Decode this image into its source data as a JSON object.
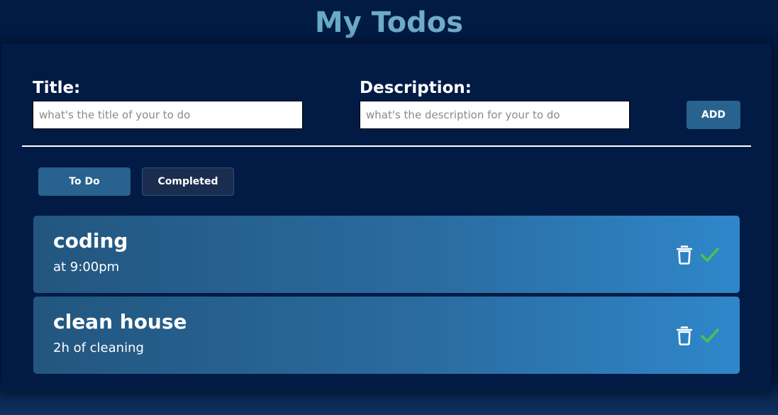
{
  "header": {
    "title": "My Todos"
  },
  "form": {
    "title_label": "Title:",
    "title_placeholder": "what's the title of your to do",
    "title_value": "",
    "description_label": "Description:",
    "description_placeholder": "what's the description for your to do",
    "description_value": "",
    "add_label": "ADD"
  },
  "tabs": [
    {
      "label": "To Do",
      "active": true
    },
    {
      "label": "Completed",
      "active": false
    }
  ],
  "todos": [
    {
      "title": "coding",
      "description": "at 9:00pm"
    },
    {
      "title": "clean house",
      "description": "2h of cleaning"
    }
  ],
  "icons": {
    "delete": "trash-icon",
    "complete": "checkmark-icon"
  },
  "colors": {
    "background": "#011b45",
    "button": "#28628e",
    "check": "#4fbf55"
  }
}
